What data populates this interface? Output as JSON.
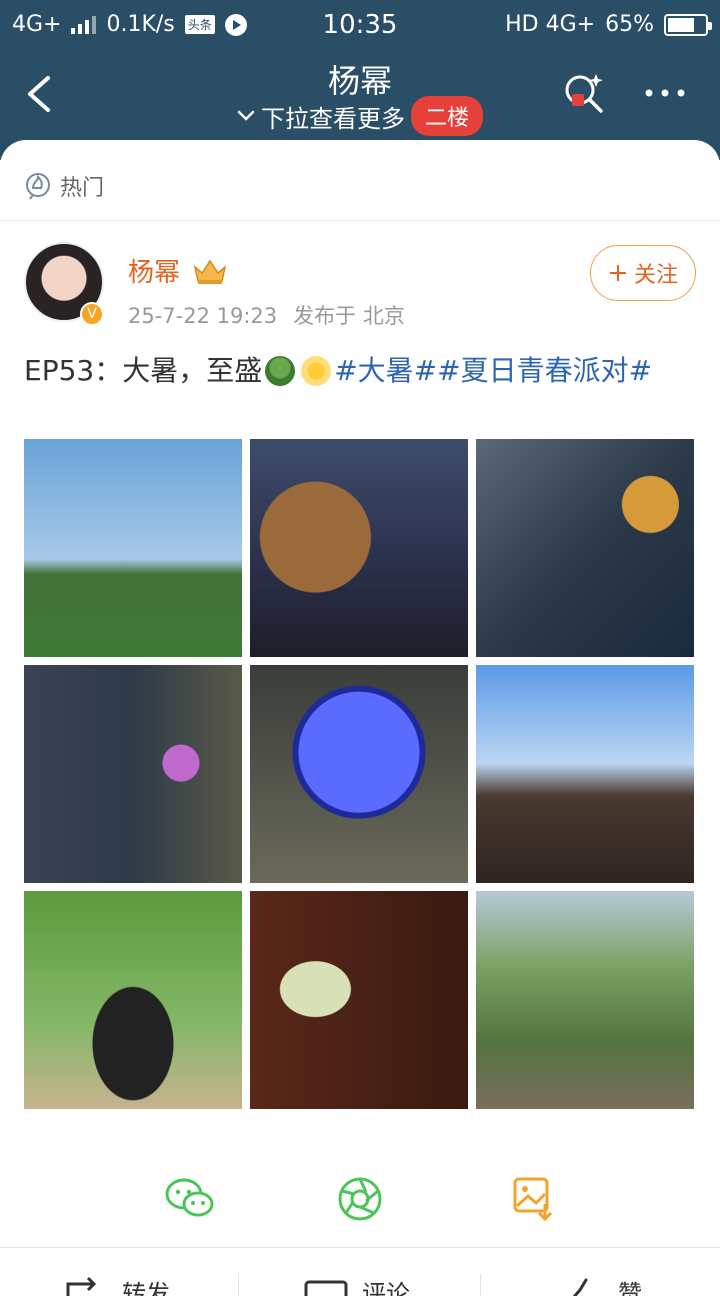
{
  "status_bar": {
    "network_left": "4G+",
    "speed": "0.1K/s",
    "app_badge": "头条",
    "time": "10:35",
    "network_right": "HD 4G+",
    "battery": "65%"
  },
  "nav": {
    "title": "杨幂",
    "subtitle": "下拉查看更多",
    "floor_button": "二楼"
  },
  "post": {
    "section_label": "热门",
    "author": {
      "name": "杨幂"
    },
    "date": "25-7-22 19:23",
    "location": "发布于 北京",
    "follow_label": "关注",
    "text_prefix": "EP53：大暑，至盛",
    "hashtags": "#大暑##夏日青春派对#",
    "images": [
      {
        "name": "rainbow-tea-field-photo"
      },
      {
        "name": "coin-sculpture-night-photo"
      },
      {
        "name": "alley-sign-photo"
      },
      {
        "name": "neon-alley-photo"
      },
      {
        "name": "blue-wheel-wall-photo"
      },
      {
        "name": "lanterns-street-photo"
      },
      {
        "name": "green-garden-photo"
      },
      {
        "name": "gourd-wall-photo"
      },
      {
        "name": "stone-steps-photo"
      }
    ]
  },
  "share_targets": [
    "wechat-icon",
    "moments-icon",
    "save-image-icon"
  ],
  "actions": {
    "repost": "转发",
    "comment": "评论",
    "like": "赞"
  },
  "colors": {
    "header_bg": "#2b4e67",
    "author_name": "#e8621f",
    "hashtag": "#2f66b3",
    "floor_badge": "#e5413a"
  }
}
